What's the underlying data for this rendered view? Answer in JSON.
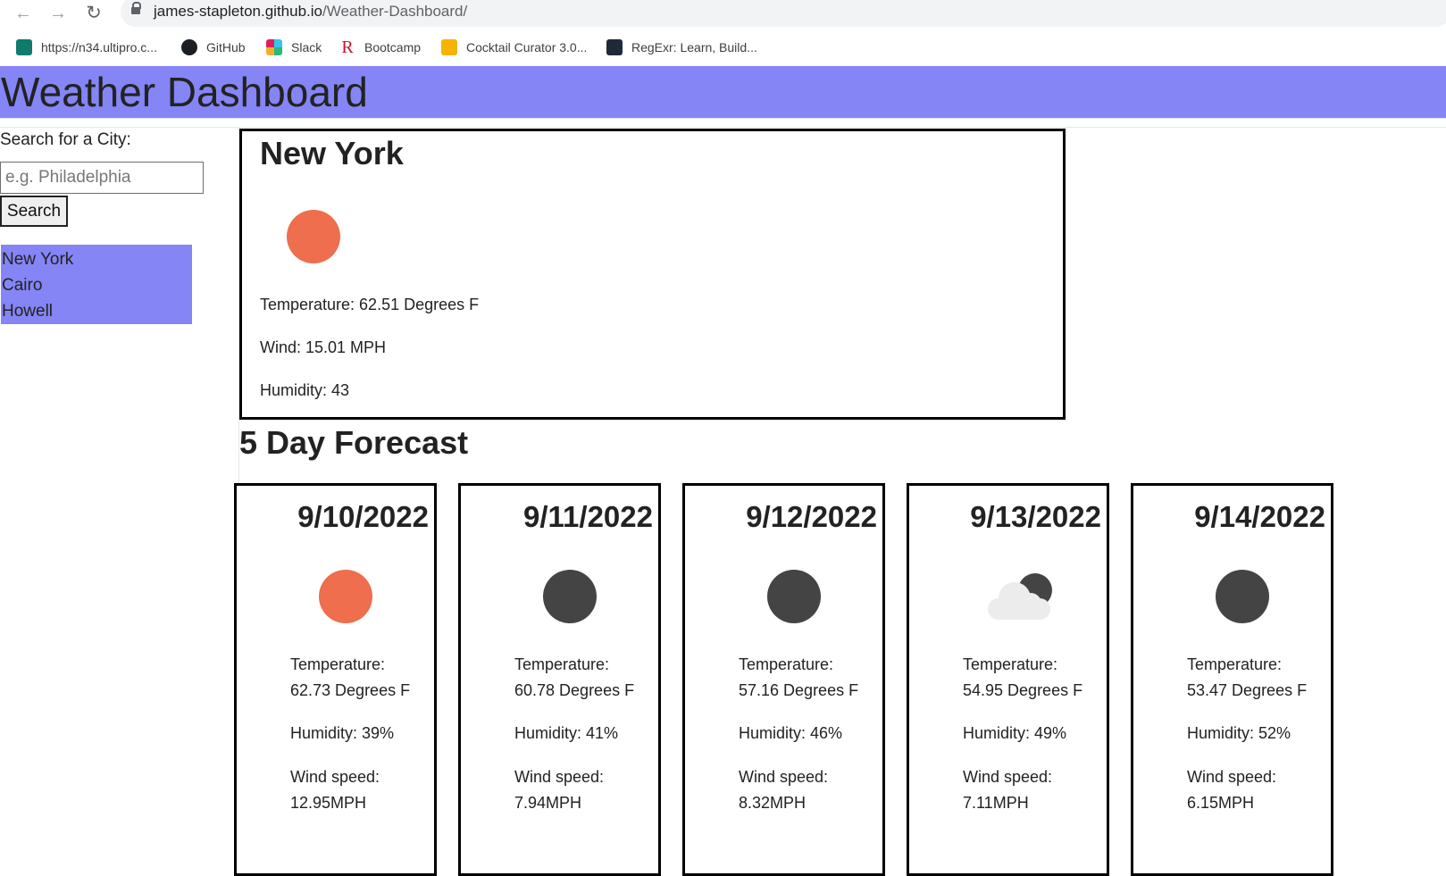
{
  "browser": {
    "url_host": "james-stapleton.github.io",
    "url_path": "/Weather-Dashboard/",
    "bookmarks": [
      {
        "label": "https://n34.ultipro.c...",
        "icon": "ultipro-icon",
        "color": "#0e7c6b"
      },
      {
        "label": "GitHub",
        "icon": "github-icon",
        "color": "#1b1f23"
      },
      {
        "label": "Slack",
        "icon": "slack-icon",
        "color": "#e01e5a"
      },
      {
        "label": "Bootcamp",
        "icon": "bootcamp-icon",
        "color": "#c8102e"
      },
      {
        "label": "Cocktail Curator 3.0...",
        "icon": "slides-icon",
        "color": "#f4b400"
      },
      {
        "label": "RegExr: Learn, Build...",
        "icon": "regexr-icon",
        "color": "#1e2a3a"
      }
    ]
  },
  "header": {
    "title": "Weather Dashboard",
    "color": "#8585f5"
  },
  "search": {
    "label": "Search for a City:",
    "placeholder": "e.g. Philadelphia",
    "button": "Search"
  },
  "history": [
    "New York",
    "Cairo",
    "Howell"
  ],
  "current": {
    "city": "New York",
    "icon": "sun-icon",
    "temperature": "Temperature: 62.51 Degrees F",
    "wind": "Wind: 15.01 MPH",
    "humidity": "Humidity: 43"
  },
  "forecast_title": "5 Day Forecast",
  "forecast": [
    {
      "date": "9/10/2022",
      "icon": "sun-icon",
      "temp_label": "Temperature:",
      "temp": "62.73 Degrees F",
      "humidity": "Humidity: 39%",
      "wind_label": "Wind speed:",
      "wind": "12.95MPH"
    },
    {
      "date": "9/11/2022",
      "icon": "moon-icon",
      "temp_label": "Temperature:",
      "temp": "60.78 Degrees F",
      "humidity": "Humidity: 41%",
      "wind_label": "Wind speed:",
      "wind": "7.94MPH"
    },
    {
      "date": "9/12/2022",
      "icon": "moon-icon",
      "temp_label": "Temperature:",
      "temp": "57.16 Degrees F",
      "humidity": "Humidity: 46%",
      "wind_label": "Wind speed:",
      "wind": "8.32MPH"
    },
    {
      "date": "9/13/2022",
      "icon": "cloud-moon-icon",
      "temp_label": "Temperature:",
      "temp": "54.95 Degrees F",
      "humidity": "Humidity: 49%",
      "wind_label": "Wind speed:",
      "wind": "7.11MPH"
    },
    {
      "date": "9/14/2022",
      "icon": "moon-icon",
      "temp_label": "Temperature:",
      "temp": "53.47 Degrees F",
      "humidity": "Humidity: 52%",
      "wind_label": "Wind speed:",
      "wind": "6.15MPH"
    }
  ]
}
